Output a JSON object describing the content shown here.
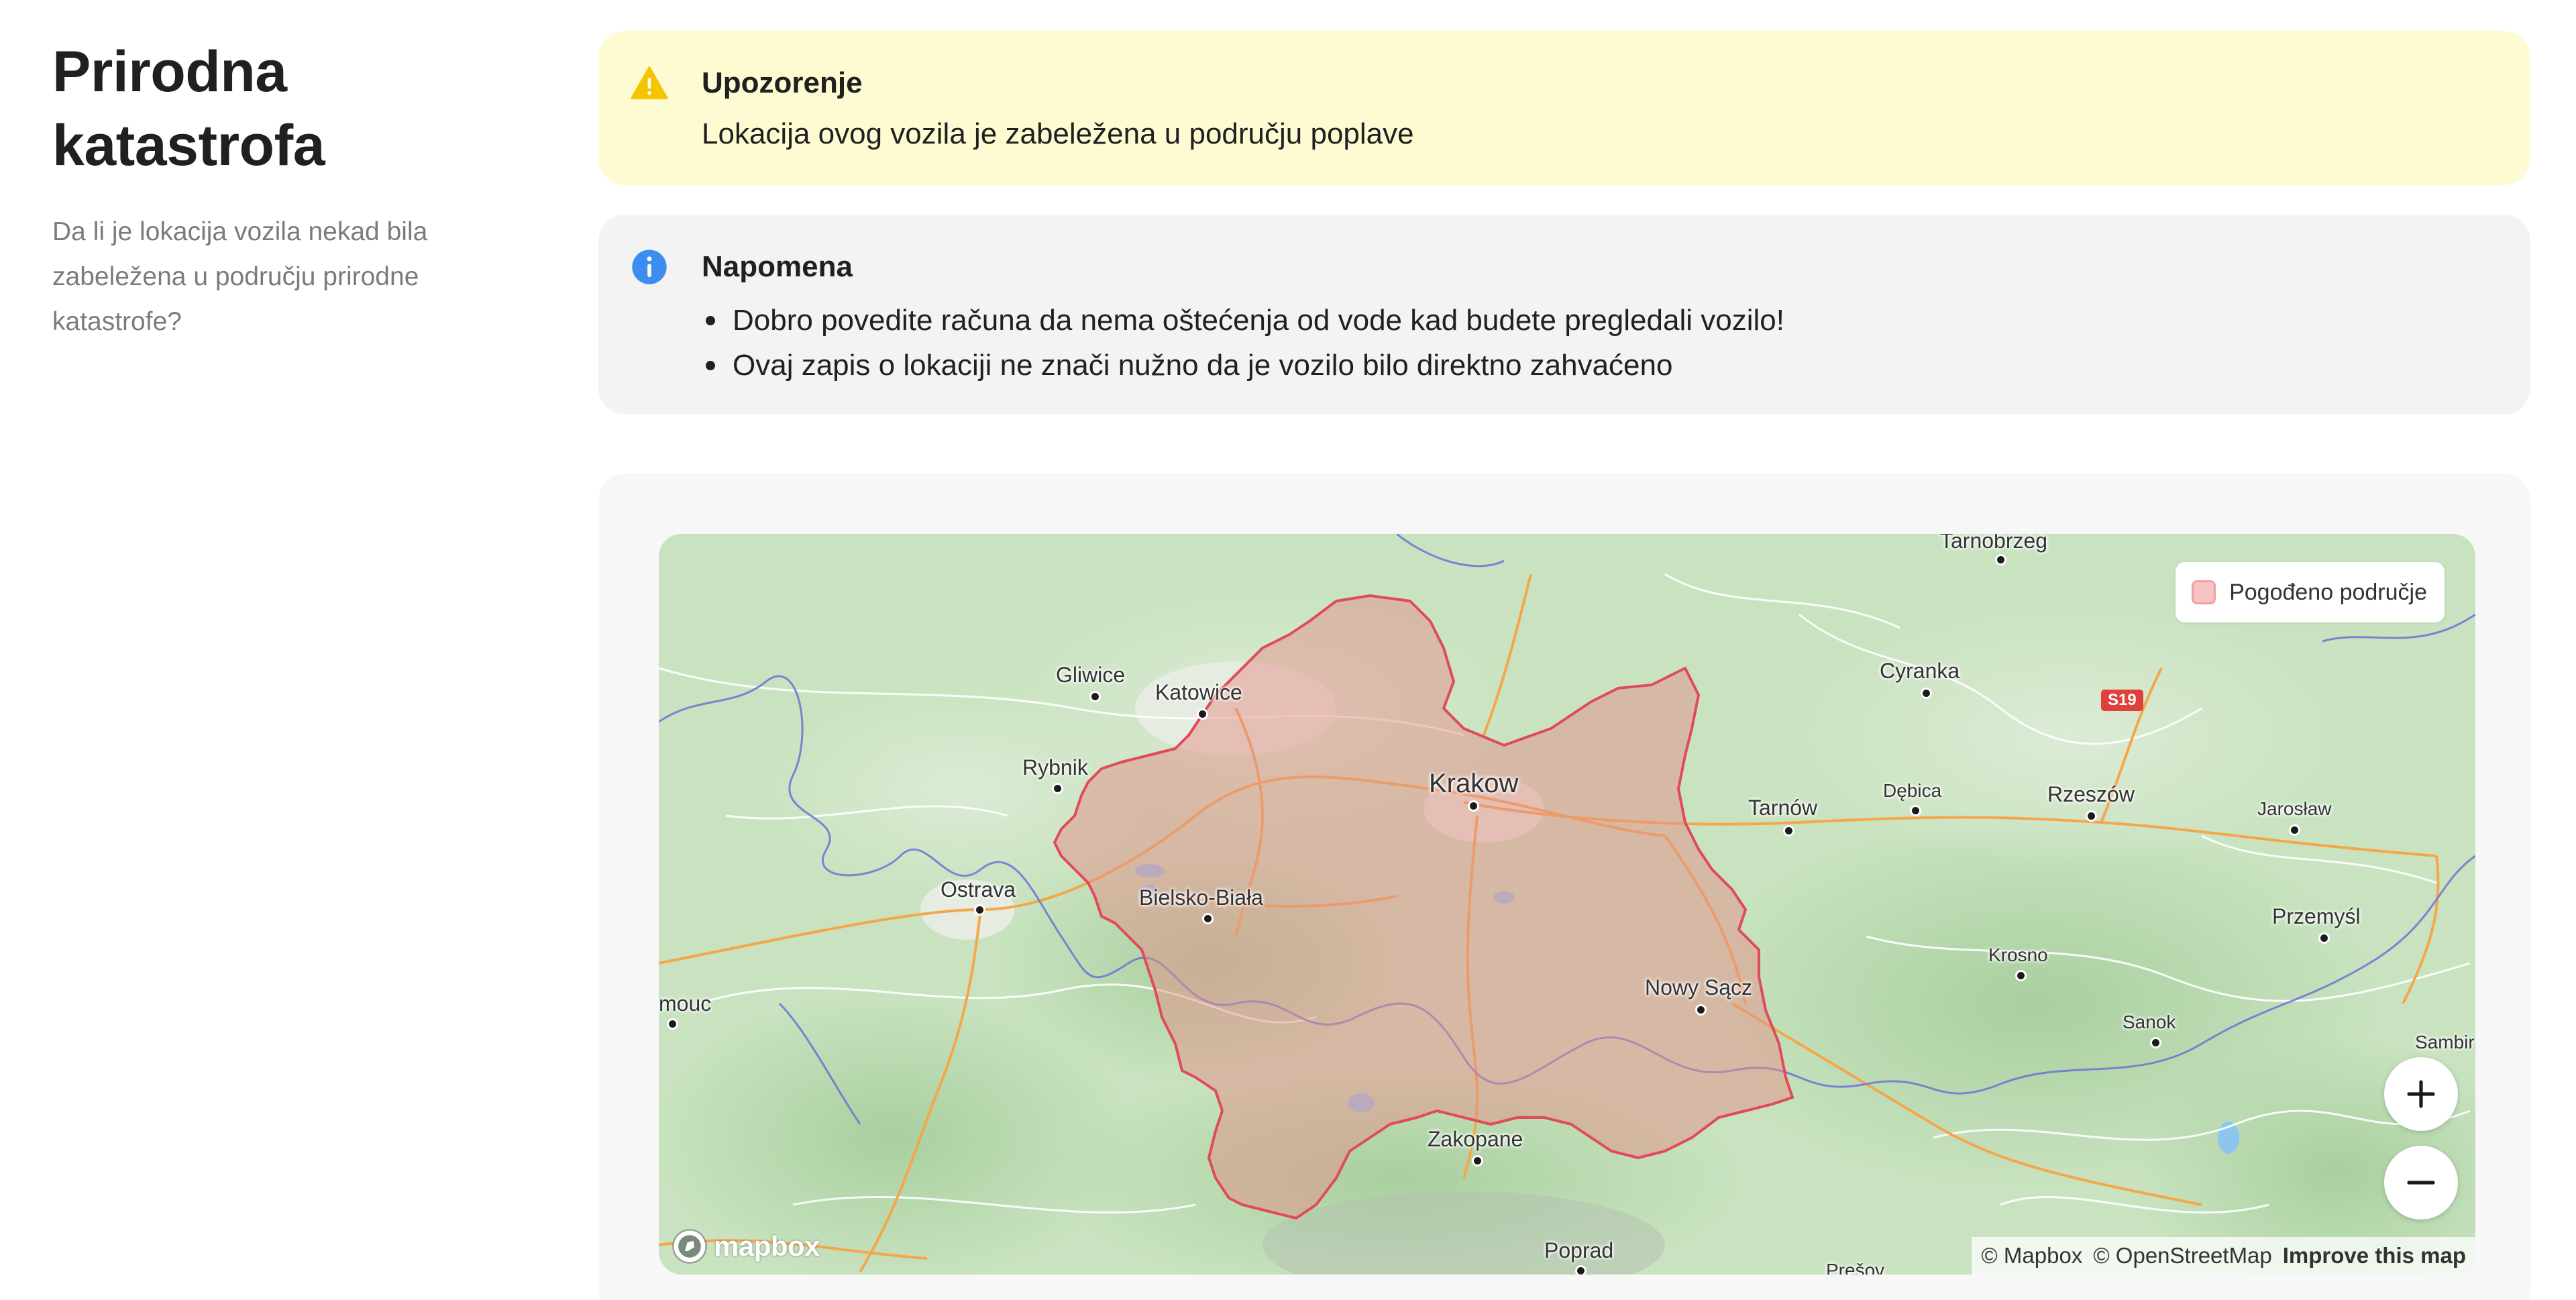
{
  "sidebar": {
    "title": "Prirodna katastrofa",
    "description": "Da li je lokacija vozila nekad bila zabeležena u području prirodne katastrofe?"
  },
  "warning": {
    "icon": "warning-icon",
    "title": "Upozorenje",
    "text": "Lokacija ovog vozila je zabeležena u području poplave",
    "color": "#fefbd2"
  },
  "info": {
    "icon": "info-icon",
    "title": "Napomena",
    "items": [
      "Dobro povedite računa da nema oštećenja od vode kad budete pregledali vozilo!",
      "Ovaj zapis o lokaciji ne znači nužno da je vozilo bilo direktno zahvaćeno"
    ],
    "color": "#f3f3f3"
  },
  "map": {
    "legend_label": "Pogođeno područje",
    "affected_color": "#e0505a",
    "zoom_in_icon": "plus-icon",
    "zoom_out_icon": "minus-icon",
    "logo_text": "mapbox",
    "attribution": {
      "mapbox": "© Mapbox",
      "osm": "© OpenStreetMap",
      "improve": "Improve this map"
    },
    "road_shield": "S19",
    "places": {
      "tarnobrzeg": "Tarnobrzeg",
      "gliwice": "Gliwice",
      "katowice": "Katowice",
      "cyranka": "Cyranka",
      "rybnik": "Rybnik",
      "krakow": "Krakow",
      "tarnow": "Tarnów",
      "debica": "Dębica",
      "rzeszow": "Rzeszów",
      "jaroslaw": "Jarosław",
      "ostrava": "Ostrava",
      "bielsko": "Bielsko-Biała",
      "przemysl": "Przemyśl",
      "krosno": "Krosno",
      "frydek": "mouc",
      "nowysacz": "Nowy Sącz",
      "sanok": "Sanok",
      "sambir": "Sambir",
      "zakopane": "Zakopane",
      "poprad": "Poprad",
      "presov": "Prešov"
    }
  }
}
